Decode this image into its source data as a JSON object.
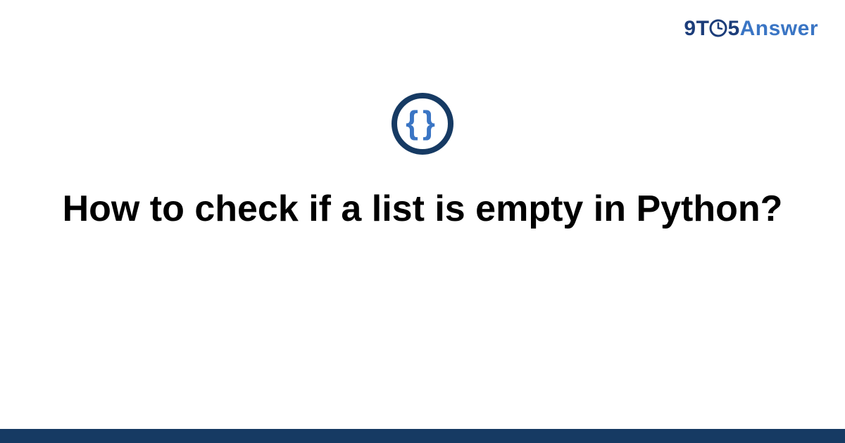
{
  "brand": {
    "part1": "9T",
    "part2": "5",
    "part3": "Answer",
    "clock_icon": "clock-icon"
  },
  "icon": {
    "name": "code-braces-icon",
    "glyph_left": "{",
    "glyph_right": "}"
  },
  "title": "How to check if a list is empty in Python?",
  "colors": {
    "navy": "#163a63",
    "blue": "#3a75c4",
    "link_navy": "#1c3d7a"
  }
}
